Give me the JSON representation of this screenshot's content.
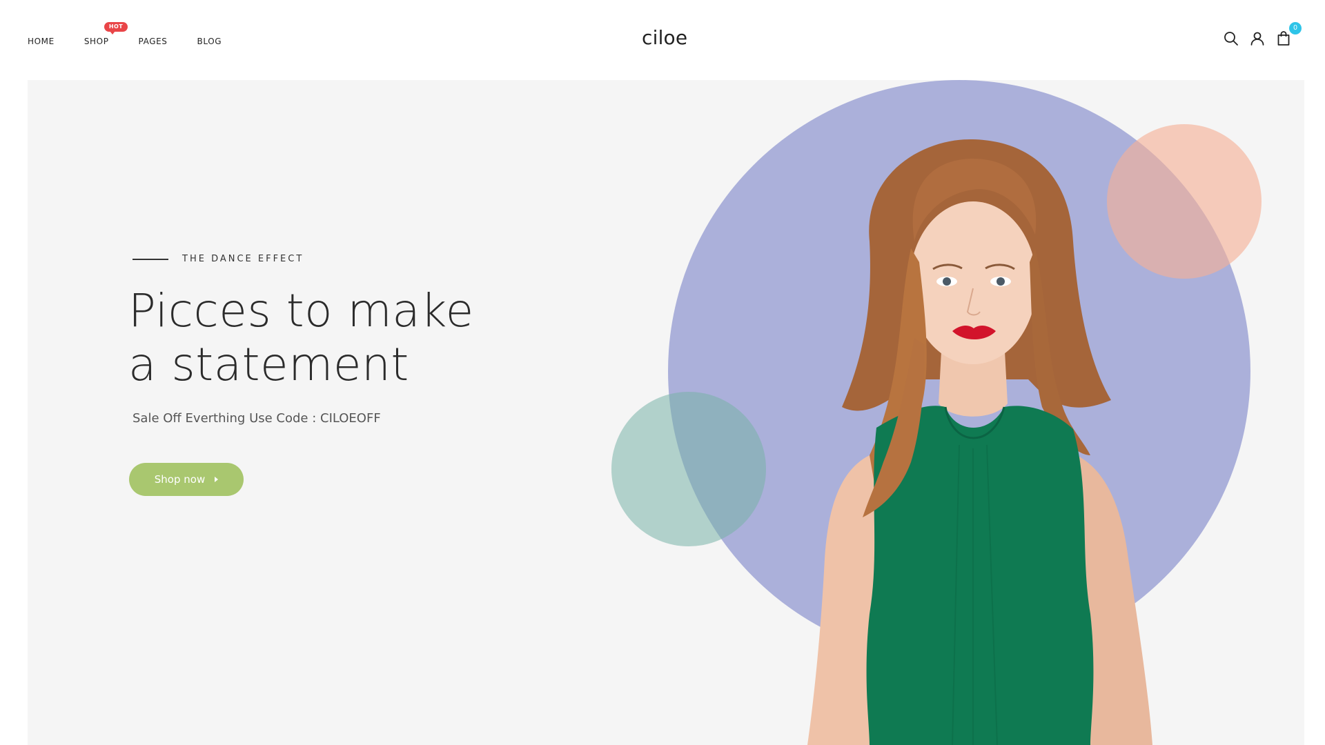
{
  "header": {
    "nav": [
      {
        "label": "HOME"
      },
      {
        "label": "SHOP",
        "badge": "HOT"
      },
      {
        "label": "PAGES"
      },
      {
        "label": "BLOG"
      }
    ],
    "logo": "ciloe",
    "icons": [
      "search-icon",
      "user-icon",
      "cart-icon"
    ],
    "cart_count": "0"
  },
  "hero": {
    "eyebrow": "THE DANCE EFFECT",
    "title_line1": "Picces to make",
    "title_line2": "a statement",
    "subtitle": "Sale Off Everthing Use Code : CILOEOFF",
    "button_label": "Shop now"
  },
  "colors": {
    "hot_badge": "#e94548",
    "cart_badge": "#2ec4e8",
    "button": "#a9c76f",
    "big_circle": "#abb0da",
    "peach_circle": "#f6b096",
    "teal_circle": "#78b2a8",
    "dress": "#0f7a52"
  }
}
